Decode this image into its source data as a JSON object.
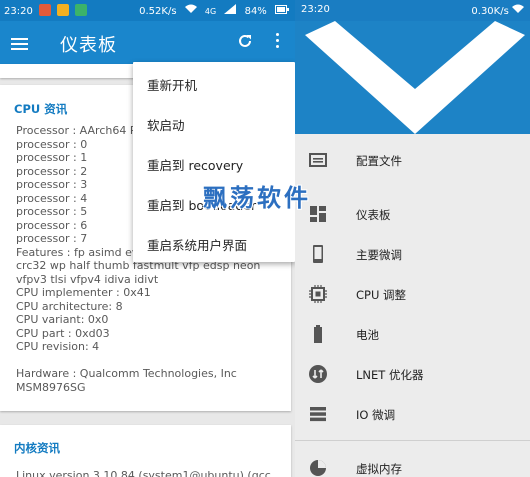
{
  "left_status": {
    "time": "23:20",
    "speed": "0.52K/s",
    "signal_label": "4G",
    "battery": "84%",
    "icons": [
      "weibo-icon",
      "qq-icon",
      "app-icon",
      "wifi-icon",
      "signal-icon",
      "battery-icon"
    ]
  },
  "appbar": {
    "title": "仪表板",
    "icons": [
      "menu-icon",
      "refresh-icon",
      "more-vert-icon"
    ]
  },
  "cpu_card": {
    "title": "CPU 资讯",
    "lines": [
      "Processor : AArch64 P",
      "processor : 0",
      "processor : 1",
      "processor : 2",
      "processor : 3",
      "processor : 4",
      "processor : 5",
      "processor : 6",
      "processor : 7",
      "Features : fp asimd ev",
      "crc32 wp half thumb fastmult vfp edsp neon",
      "vfpv3 tlsi vfpv4 idiva idivt",
      "CPU implementer : 0x41",
      "CPU architecture: 8",
      "CPU variant: 0x0",
      "CPU part : 0xd03",
      "CPU revision: 4",
      "",
      "Hardware : Qualcomm Technologies, Inc",
      "MSM8976SG"
    ]
  },
  "kernel_card": {
    "title": "内核资讯",
    "line": "Linux version 3.10.84 (system1@ubuntu) (gcc"
  },
  "menu": {
    "items": [
      "重新开机",
      "软启动",
      "重启到 recovery",
      "重启到 bootloader",
      "重启系统用户界面"
    ]
  },
  "right_status": {
    "time": "23:20",
    "speed": "0.30K/s"
  },
  "nav": {
    "items": [
      {
        "label": "配置文件",
        "icon": "profile-icon"
      },
      {
        "label": "仪表板",
        "icon": "dashboard-icon"
      },
      {
        "label": "主要微调",
        "icon": "phone-icon"
      },
      {
        "label": "CPU 调整",
        "icon": "cpu-icon"
      },
      {
        "label": "电池",
        "icon": "battery-icon"
      },
      {
        "label": "LNET 优化器",
        "icon": "lnet-icon"
      },
      {
        "label": "IO 微调",
        "icon": "io-icon"
      },
      {
        "label": "虚拟内存",
        "icon": "pie-chart-icon"
      }
    ]
  },
  "watermark": "飘荡软件",
  "colors": {
    "primary": "#1a86cc",
    "status_bar": "#137bc1",
    "accent_text": "#137bc1",
    "background": "#e8e8e8"
  }
}
